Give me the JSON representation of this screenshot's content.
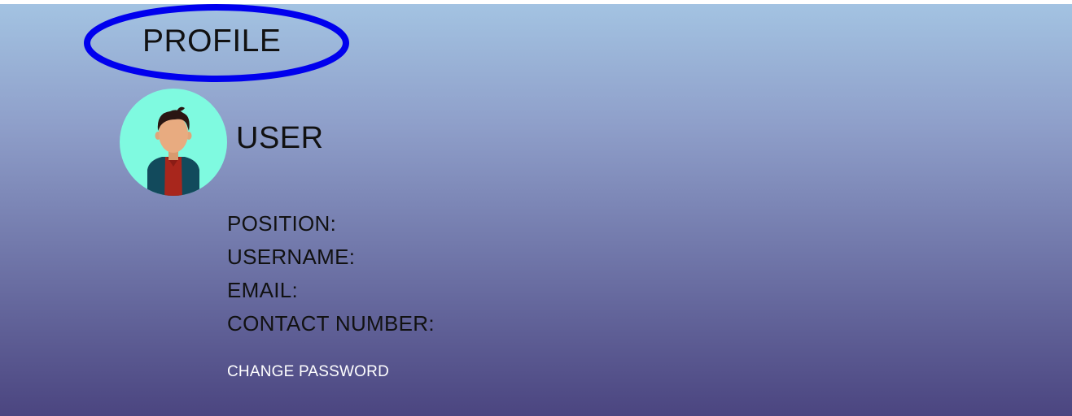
{
  "header": {
    "title": "PROFILE",
    "highlight_color": "#0000ee"
  },
  "profile": {
    "avatar_icon": "user-avatar-icon",
    "avatar_bg_color": "#7ffae0",
    "name": "USER"
  },
  "details": {
    "position_label": "POSITION:",
    "username_label": "USERNAME:",
    "email_label": "EMAIL:",
    "contact_label": "CONTACT NUMBER:"
  },
  "actions": {
    "change_password_label": "CHANGE PASSWORD"
  },
  "colors": {
    "gradient_top": "#a3c3e2",
    "gradient_bottom": "#4b4580",
    "text": "#111111",
    "link": "#ffffff"
  }
}
